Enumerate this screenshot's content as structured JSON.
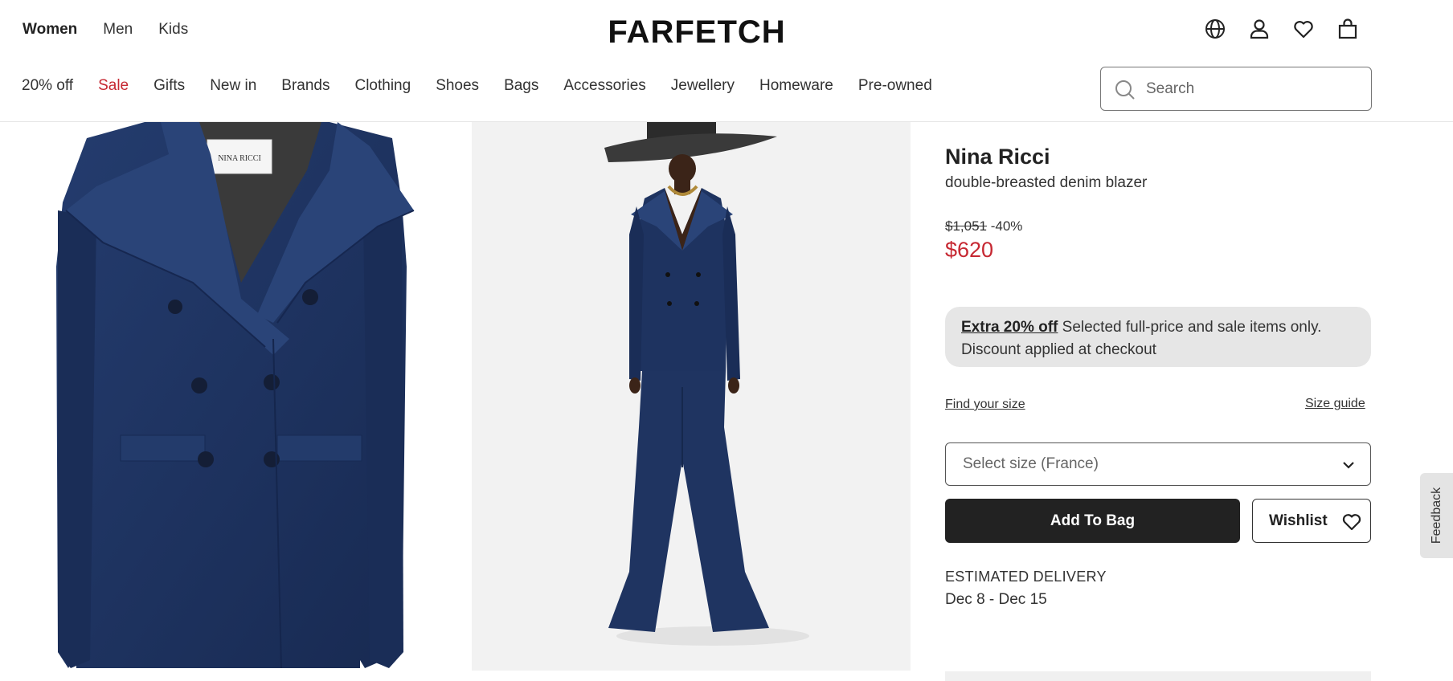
{
  "header": {
    "gender_tabs": [
      "Women",
      "Men",
      "Kids"
    ],
    "logo": "FARFETCH",
    "icons": [
      "globe-icon",
      "account-icon",
      "heart-icon",
      "bag-icon"
    ]
  },
  "categories": [
    "20% off",
    "Sale",
    "Gifts",
    "New in",
    "Brands",
    "Clothing",
    "Shoes",
    "Bags",
    "Accessories",
    "Jewellery",
    "Homeware",
    "Pre-owned"
  ],
  "search": {
    "placeholder": "Search"
  },
  "product": {
    "brand": "Nina Ricci",
    "name": "double-breasted denim blazer",
    "label_text": "NINA RICCI",
    "original_price": "$1,051",
    "discount": "-40%",
    "price": "$620"
  },
  "promo": {
    "link": "Extra 20% off",
    "text": " Selected full-price and sale items only. Discount applied at checkout"
  },
  "size": {
    "find_size": "Find your size",
    "size_guide": "Size guide",
    "select_placeholder": "Select size (France)"
  },
  "actions": {
    "add_to_bag": "Add To Bag",
    "wishlist": "Wishlist"
  },
  "delivery": {
    "label": "ESTIMATED DELIVERY",
    "dates": "Dec 8 - Dec 15"
  },
  "feedback": "Feedback",
  "colors": {
    "sale_red": "#c62832",
    "button_dark": "#222222",
    "promo_bg": "#e6e6e6",
    "denim": "#1e3360"
  }
}
